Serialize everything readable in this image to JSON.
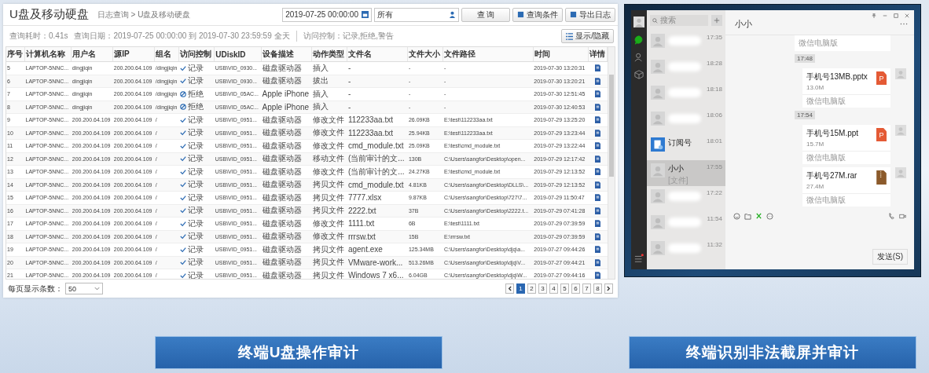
{
  "left_panel": {
    "title": "U盘及移动硬盘",
    "breadcrumb": "日志查询 > U盘及移动硬盘",
    "date_field": {
      "value": "2019-07-25 00:00:00"
    },
    "user_field": {
      "value": "所有"
    },
    "search_button": "查 询",
    "buttons": [
      "查询条件",
      "导出日志"
    ],
    "info": [
      "查询耗时：0.41s",
      "查询日期：2019-07-25 00:00:00 到 2019-07-30 23:59:59 全天",
      "访问控制：记录,拒绝,警告"
    ],
    "toggle_button": "显示/隐藏",
    "table": {
      "columns": [
        "序号",
        "计算机名称",
        "用户名",
        "源IP",
        "组名",
        "访问控制",
        "UDiskID",
        "设备描述",
        "动作类型",
        "文件名",
        "文件大小",
        "文件路径",
        "时间",
        "详情"
      ],
      "rows": [
        {
          "no": "5",
          "computer": "LAPTOP-5NNC...",
          "user": "dingjiqin",
          "ip": "200.200.64.109",
          "group": "/dingjiqin",
          "access": {
            "kind": "allow",
            "label": "记录"
          },
          "udisk": "USB\\VID_0930...",
          "device": "磁盘驱动器",
          "action": "插入",
          "file": "-",
          "size": "-",
          "path": "-",
          "time": "2019-07-30 13:20:31"
        },
        {
          "no": "6",
          "computer": "LAPTOP-5NNC...",
          "user": "dingjiqin",
          "ip": "200.200.64.109",
          "group": "/dingjiqin",
          "access": {
            "kind": "allow",
            "label": "记录"
          },
          "udisk": "USB\\VID_0930...",
          "device": "磁盘驱动器",
          "action": "拔出",
          "file": "-",
          "size": "-",
          "path": "-",
          "time": "2019-07-30 13:20:21"
        },
        {
          "no": "7",
          "computer": "LAPTOP-5NNC...",
          "user": "dingjiqin",
          "ip": "200.200.64.109",
          "group": "/dingjiqin",
          "access": {
            "kind": "deny",
            "label": "拒绝"
          },
          "udisk": "USB\\VID_05AC...",
          "device": "Apple iPhone",
          "action": "插入",
          "file": "-",
          "size": "-",
          "path": "-",
          "time": "2019-07-30 12:51:45"
        },
        {
          "no": "8",
          "computer": "LAPTOP-5NNC...",
          "user": "dingjiqin",
          "ip": "200.200.64.109",
          "group": "/dingjiqin",
          "access": {
            "kind": "deny",
            "label": "拒绝"
          },
          "udisk": "USB\\VID_05AC...",
          "device": "Apple iPhone",
          "action": "插入",
          "file": "-",
          "size": "-",
          "path": "-",
          "time": "2019-07-30 12:40:53"
        },
        {
          "no": "9",
          "computer": "LAPTOP-5NNC...",
          "user": "200.200.64.109",
          "ip": "200.200.64.109",
          "group": "/",
          "access": {
            "kind": "allow",
            "label": "记录"
          },
          "udisk": "USB\\VID_0951...",
          "device": "磁盘驱动器",
          "action": "修改文件",
          "file": "112233aa.txt",
          "size": "26.09KB",
          "path": "E:\\test\\112233aa.txt",
          "time": "2019-07-29 13:25:20"
        },
        {
          "no": "10",
          "computer": "LAPTOP-5NNC...",
          "user": "200.200.64.109",
          "ip": "200.200.64.109",
          "group": "/",
          "access": {
            "kind": "allow",
            "label": "记录"
          },
          "udisk": "USB\\VID_0951...",
          "device": "磁盘驱动器",
          "action": "修改文件",
          "file": "112233aa.txt",
          "size": "25.94KB",
          "path": "E:\\test\\112233aa.txt",
          "time": "2019-07-29 13:23:44"
        },
        {
          "no": "11",
          "computer": "LAPTOP-5NNC...",
          "user": "200.200.64.109",
          "ip": "200.200.64.109",
          "group": "/",
          "access": {
            "kind": "allow",
            "label": "记录"
          },
          "udisk": "USB\\VID_0951...",
          "device": "磁盘驱动器",
          "action": "修改文件",
          "file": "cmd_module.txt",
          "size": "25.09KB",
          "path": "E:\\test\\cmd_module.txt",
          "time": "2019-07-29 13:22:44"
        },
        {
          "no": "12",
          "computer": "LAPTOP-5NNC...",
          "user": "200.200.64.109",
          "ip": "200.200.64.109",
          "group": "/",
          "access": {
            "kind": "allow",
            "label": "记录"
          },
          "udisk": "USB\\VID_0951...",
          "device": "磁盘驱动器",
          "action": "移动文件",
          "file": "(当前审计的文...",
          "size": "130B",
          "path": "C:\\Users\\sangfor\\Desktop\\open...",
          "time": "2019-07-29 12:17:42"
        },
        {
          "no": "13",
          "computer": "LAPTOP-5NNC...",
          "user": "200.200.64.109",
          "ip": "200.200.64.109",
          "group": "/",
          "access": {
            "kind": "allow",
            "label": "记录"
          },
          "udisk": "USB\\VID_0951...",
          "device": "磁盘驱动器",
          "action": "修改文件",
          "file": "(当前审计的文...",
          "size": "24.27KB",
          "path": "E:\\test\\cmd_module.txt",
          "time": "2019-07-29 12:13:52"
        },
        {
          "no": "14",
          "computer": "LAPTOP-5NNC...",
          "user": "200.200.64.109",
          "ip": "200.200.64.109",
          "group": "/",
          "access": {
            "kind": "allow",
            "label": "记录"
          },
          "udisk": "USB\\VID_0951...",
          "device": "磁盘驱动器",
          "action": "拷贝文件",
          "file": "cmd_module.txt",
          "size": "4.81KB",
          "path": "C:\\Users\\sangfor\\Desktop\\DLLS\\...",
          "time": "2019-07-29 12:13:52"
        },
        {
          "no": "15",
          "computer": "LAPTOP-5NNC...",
          "user": "200.200.64.109",
          "ip": "200.200.64.109",
          "group": "/",
          "access": {
            "kind": "allow",
            "label": "记录"
          },
          "udisk": "USB\\VID_0951...",
          "device": "磁盘驱动器",
          "action": "拷贝文件",
          "file": "7777.xlsx",
          "size": "9.87KB",
          "path": "C:\\Users\\sangfor\\Desktop\\727\\7...",
          "time": "2019-07-29 11:50:47"
        },
        {
          "no": "16",
          "computer": "LAPTOP-5NNC...",
          "user": "200.200.64.109",
          "ip": "200.200.64.109",
          "group": "/",
          "access": {
            "kind": "allow",
            "label": "记录"
          },
          "udisk": "USB\\VID_0951...",
          "device": "磁盘驱动器",
          "action": "拷贝文件",
          "file": "2222.txt",
          "size": "37B",
          "path": "C:\\Users\\sangfor\\Desktop\\2222.t...",
          "time": "2019-07-29 07:41:28"
        },
        {
          "no": "17",
          "computer": "LAPTOP-5NNC...",
          "user": "200.200.64.109",
          "ip": "200.200.64.109",
          "group": "/",
          "access": {
            "kind": "allow",
            "label": "记录"
          },
          "udisk": "USB\\VID_0951...",
          "device": "磁盘驱动器",
          "action": "修改文件",
          "file": "1111.txt",
          "size": "6B",
          "path": "E:\\test\\1111.txt",
          "time": "2019-07-29 07:39:59"
        },
        {
          "no": "18",
          "computer": "LAPTOP-5NNC...",
          "user": "200.200.64.109",
          "ip": "200.200.64.109",
          "group": "/",
          "access": {
            "kind": "allow",
            "label": "记录"
          },
          "udisk": "USB\\VID_0951...",
          "device": "磁盘驱动器",
          "action": "修改文件",
          "file": "rrrsw.txt",
          "size": "15B",
          "path": "E:\\rrrsw.txt",
          "time": "2019-07-29 07:39:59"
        },
        {
          "no": "19",
          "computer": "LAPTOP-5NNC...",
          "user": "200.200.64.109",
          "ip": "200.200.64.109",
          "group": "/",
          "access": {
            "kind": "allow",
            "label": "记录"
          },
          "udisk": "USB\\VID_0951...",
          "device": "磁盘驱动器",
          "action": "拷贝文件",
          "file": "agent.exe",
          "size": "125.34MB",
          "path": "C:\\Users\\sangfor\\Desktop\\djq\\a...",
          "time": "2019-07-27 09:44:26"
        },
        {
          "no": "20",
          "computer": "LAPTOP-5NNC...",
          "user": "200.200.64.109",
          "ip": "200.200.64.109",
          "group": "/",
          "access": {
            "kind": "allow",
            "label": "记录"
          },
          "udisk": "USB\\VID_0951...",
          "device": "磁盘驱动器",
          "action": "拷贝文件",
          "file": "VMware-work...",
          "size": "513.26MB",
          "path": "C:\\Users\\sangfor\\Desktop\\djq\\V...",
          "time": "2019-07-27 09:44:21"
        },
        {
          "no": "21",
          "computer": "LAPTOP-5NNC...",
          "user": "200.200.64.109",
          "ip": "200.200.64.109",
          "group": "/",
          "access": {
            "kind": "allow",
            "label": "记录"
          },
          "udisk": "USB\\VID_0951...",
          "device": "磁盘驱动器",
          "action": "拷贝文件",
          "file": "Windows 7 x6...",
          "size": "6.04GB",
          "path": "C:\\Users\\sangfor\\Desktop\\djq\\W...",
          "time": "2019-07-27 09:44:16"
        }
      ]
    },
    "page_size": {
      "label": "每页显示条数：",
      "value": "50"
    },
    "pages": [
      {
        "label": "1",
        "selected": true
      },
      {
        "label": "2",
        "selected": false
      },
      {
        "label": "3",
        "selected": false
      },
      {
        "label": "4",
        "selected": false
      },
      {
        "label": "5",
        "selected": false
      },
      {
        "label": "6",
        "selected": false
      },
      {
        "label": "7",
        "selected": false
      },
      {
        "label": "8",
        "selected": false
      }
    ],
    "caption": "终端U盘操作审计"
  },
  "chat_window": {
    "nav": [
      {
        "kind": "chat",
        "selected": true
      },
      {
        "kind": "contacts",
        "selected": false
      },
      {
        "kind": "apps",
        "selected": false
      }
    ],
    "search": {
      "placeholder": "搜索"
    },
    "chats": [
      {
        "kind": "blurred",
        "time": "17:35",
        "selected": false
      },
      {
        "kind": "blurred",
        "time": "18:28",
        "selected": false
      },
      {
        "kind": "blurred",
        "time": "18:18",
        "selected": false
      },
      {
        "kind": "blurred",
        "time": "18:06",
        "selected": false
      },
      {
        "kind": "subscription",
        "name": "订阅号",
        "time": "18:01",
        "selected": false
      },
      {
        "kind": "contact",
        "name": "小小",
        "preview": "[文件]",
        "time": "17:55",
        "selected": true
      },
      {
        "kind": "blurred",
        "time": "17:22",
        "selected": false
      },
      {
        "kind": "blurred",
        "time": "11:54",
        "selected": false
      },
      {
        "kind": "blurred",
        "time": "11:32",
        "selected": false
      }
    ],
    "title": "小小",
    "messages": [
      {
        "kind": "footer",
        "source": "微信电脑版"
      },
      {
        "kind": "time",
        "text": "17:48"
      },
      {
        "kind": "slides_file",
        "name": "手机号13MB.pptx",
        "size": "13.0M",
        "source": "微信电脑版",
        "badge": "P"
      },
      {
        "kind": "time",
        "text": "17:54"
      },
      {
        "kind": "slides_file",
        "name": "手机号15M.ppt",
        "size": "15.7M",
        "source": "微信电脑版",
        "badge": "P"
      },
      {
        "kind": "archive_file",
        "name": "手机号27M.rar",
        "size": "27.4M",
        "source": "微信电脑版"
      }
    ],
    "send_button": "发送(S)",
    "caption": "终端识别非法截屏并审计"
  }
}
